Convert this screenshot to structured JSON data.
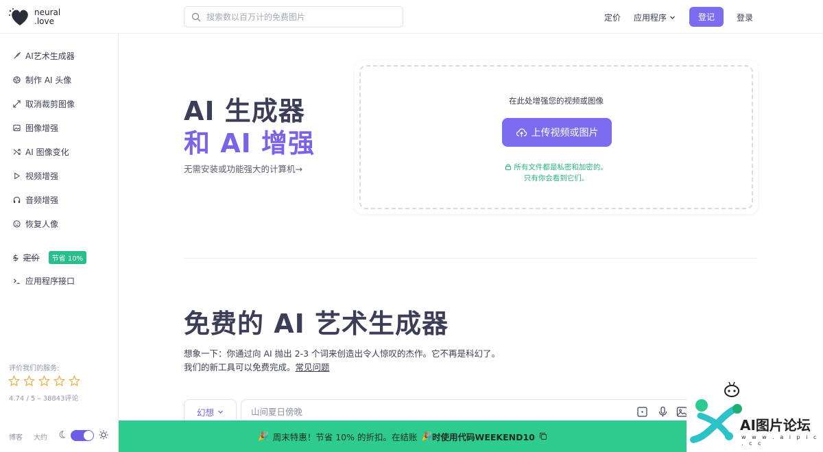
{
  "header": {
    "logo_line1": "neural",
    "logo_line2": ".love",
    "search_placeholder": "搜索数以百万计的免费图片",
    "nav_pricing": "定价",
    "nav_apps": "应用程序",
    "signup": "登记",
    "login": "登录"
  },
  "sidebar": {
    "items": [
      {
        "label": "AI艺术生成器",
        "icon": "brush-icon"
      },
      {
        "label": "制作 AI 头像",
        "icon": "aperture-icon"
      },
      {
        "label": "取消裁剪图像",
        "icon": "expand-icon"
      },
      {
        "label": "图像增强",
        "icon": "image-icon"
      },
      {
        "label": "AI 图像变化",
        "icon": "shuffle-icon"
      },
      {
        "label": "视频增强",
        "icon": "play-icon"
      },
      {
        "label": "音频增强",
        "icon": "headphones-icon"
      },
      {
        "label": "恢复人像",
        "icon": "smile-icon"
      }
    ],
    "pricing_label": "定价",
    "pricing_badge": "节省 10%",
    "api_label": "应用程序接口",
    "rate_label": "评价我们的服务:",
    "rating_value": "4.74 / 5 – 38843评论",
    "rating_stars": 5,
    "footer_blog": "博客",
    "footer_about": "大约"
  },
  "hero": {
    "title_line1": "AI 生成器",
    "title_line2": "和 AI 增强",
    "subtitle": "无需安装或功能强大的计算机→",
    "upload_prompt": "在此处增强您的视频或图像",
    "upload_button": "上传视频或图片",
    "privacy_line1": "所有文件都是私密和加密的。",
    "privacy_line2": "只有你会看到它们。"
  },
  "generator": {
    "title": "免费的 AI 艺术生成器",
    "desc_line1": "想象一下：你通过向 AI 抛出 2-3 个词来创造出令人惊叹的杰作。它不再是科幻了。",
    "desc_line2": "我们的新工具可以免费完成。",
    "faq_link": "常见问题",
    "style_value": "幻想",
    "prompt_placeholder": "山间夏日傍晚"
  },
  "promo": {
    "text": "周末特惠！节省 10% 的折扣。在结账",
    "text2": "时使用代码WEEKEND10"
  },
  "watermark": {
    "text": "AI图片论坛",
    "url": "w w w . a i p i c . c c"
  },
  "colors": {
    "accent": "#7b6cf0",
    "green": "#2ecb8f",
    "text": "#3b3e56"
  }
}
